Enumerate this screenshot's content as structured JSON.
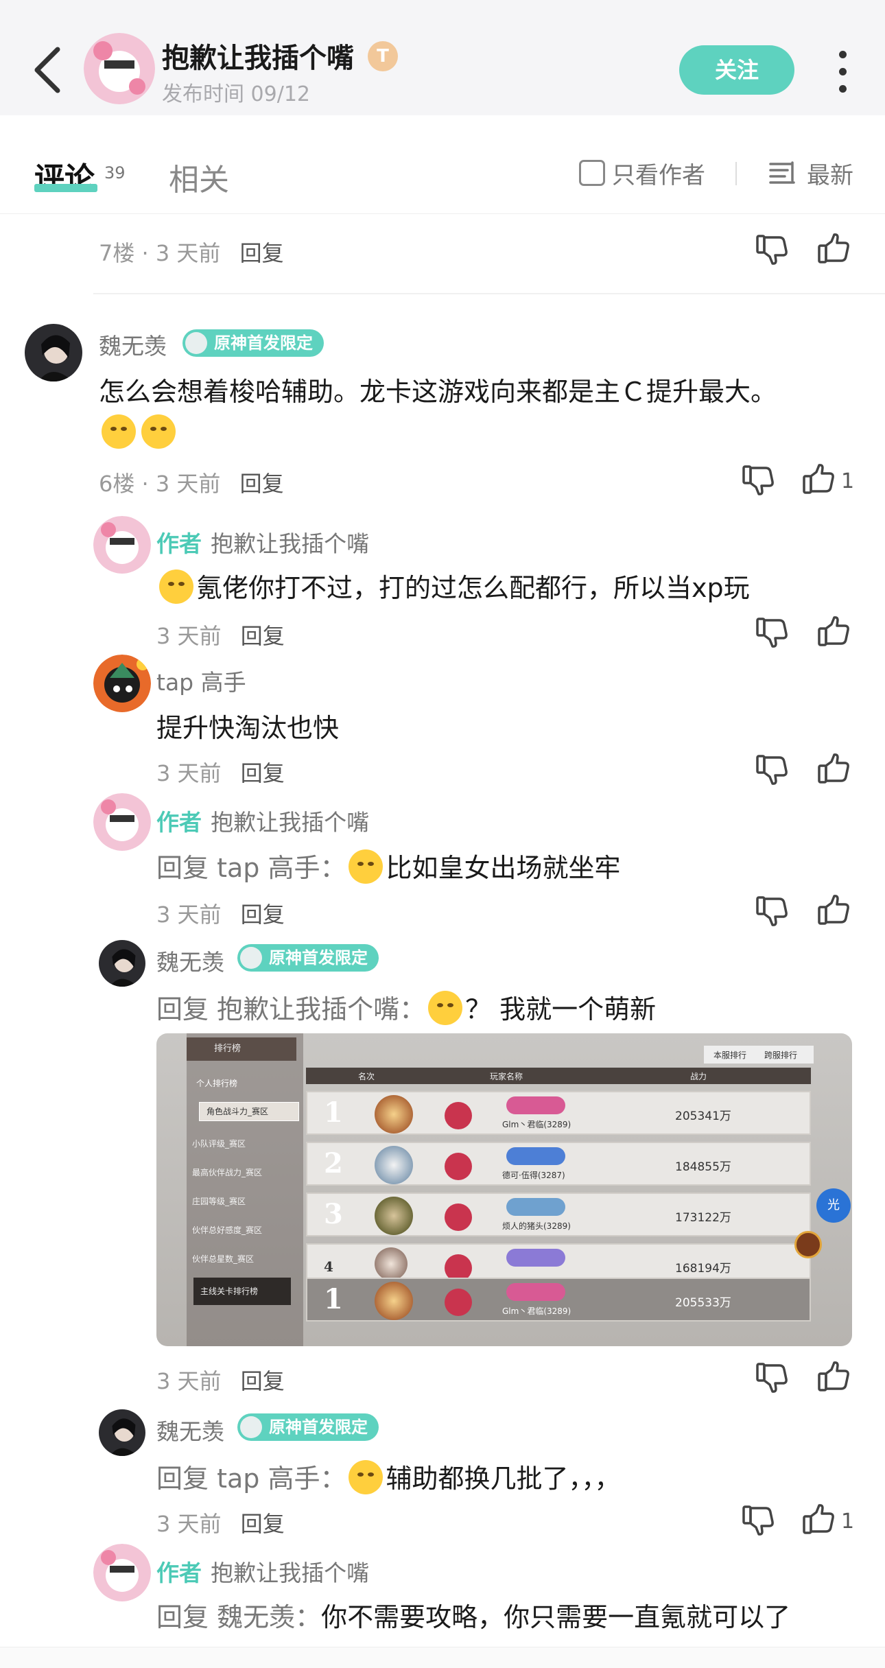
{
  "header": {
    "title": "抱歉让我插个嘴",
    "level_badge": "T",
    "publish_time": "发布时间 09/12",
    "follow_label": "关注"
  },
  "tabs": {
    "comments_label": "评论",
    "comments_count": "39",
    "related_label": "相关",
    "author_only_label": "只看作者",
    "sort_label": "最新"
  },
  "comments": {
    "floor7": {
      "meta": "7楼 · 3 天前",
      "reply": "回复"
    },
    "floor6": {
      "name": "魏无羡",
      "badge": "原神首发限定",
      "text": "怎么会想着梭哈辅助。龙卡这游戏向来都是主Ｃ提升最大。",
      "meta": "6楼 · 3 天前",
      "reply": "回复",
      "likes": "1"
    },
    "r1": {
      "author_tag": "作者",
      "name": "抱歉让我插个嘴",
      "text": "氪佬你打不过，打的过怎么配都行，所以当xp玩",
      "meta": "3 天前",
      "reply": "回复"
    },
    "r2": {
      "name": "tap 高手",
      "text": "提升快淘汰也快",
      "meta": "3 天前",
      "reply": "回复"
    },
    "r3": {
      "author_tag": "作者",
      "name": "抱歉让我插个嘴",
      "reply_to": "回复 tap 高手：",
      "text": "比如皇女出场就坐牢",
      "meta": "3 天前",
      "reply": "回复"
    },
    "r4": {
      "name": "魏无羡",
      "badge": "原神首发限定",
      "reply_to": "回复 抱歉让我插个嘴：",
      "text_q": "？",
      "text": "我就一个萌新",
      "meta": "3 天前",
      "reply": "回复"
    },
    "r5": {
      "name": "魏无羡",
      "badge": "原神首发限定",
      "reply_to": "回复 tap 高手：",
      "text": "辅助都换几批了，，，",
      "meta": "3 天前",
      "reply": "回复",
      "likes": "1"
    },
    "r6": {
      "author_tag": "作者",
      "name": "抱歉让我插个嘴",
      "reply_to": "回复 魏无羡：",
      "text": "你不需要攻略，你只需要一直氪就可以了"
    }
  },
  "screenshot": {
    "title": "排行榜",
    "tab_local": "本服排行",
    "tab_cross": "跨服排行",
    "col_rank": "名次",
    "col_player": "玩家名称",
    "col_power": "战力",
    "menu_personal": "个人排行榜",
    "menu_items": [
      "角色战斗力_赛区",
      "小队评级_赛区",
      "最高伙伴战力_赛区",
      "庄园等级_赛区",
      "伙伴总好感度_赛区",
      "伙伴总星数_赛区"
    ],
    "menu_bottom": "主线关卡排行榜",
    "fab_label": "光",
    "rows": [
      {
        "rank": "1",
        "name": "Glm丶君临(3289)",
        "power": "205341万"
      },
      {
        "rank": "2",
        "name": "德可·伍得(3287)",
        "power": "184855万"
      },
      {
        "rank": "3",
        "name": "烦人的猪头(3289)",
        "power": "173122万"
      },
      {
        "rank": "4",
        "name": "",
        "power": "168194万"
      },
      {
        "rank": "1",
        "name": "Glm丶君临(3289)",
        "power": "205533万"
      }
    ]
  },
  "colors": {
    "accent": "#5ed2bf",
    "author_tag": "#4ccab6"
  }
}
